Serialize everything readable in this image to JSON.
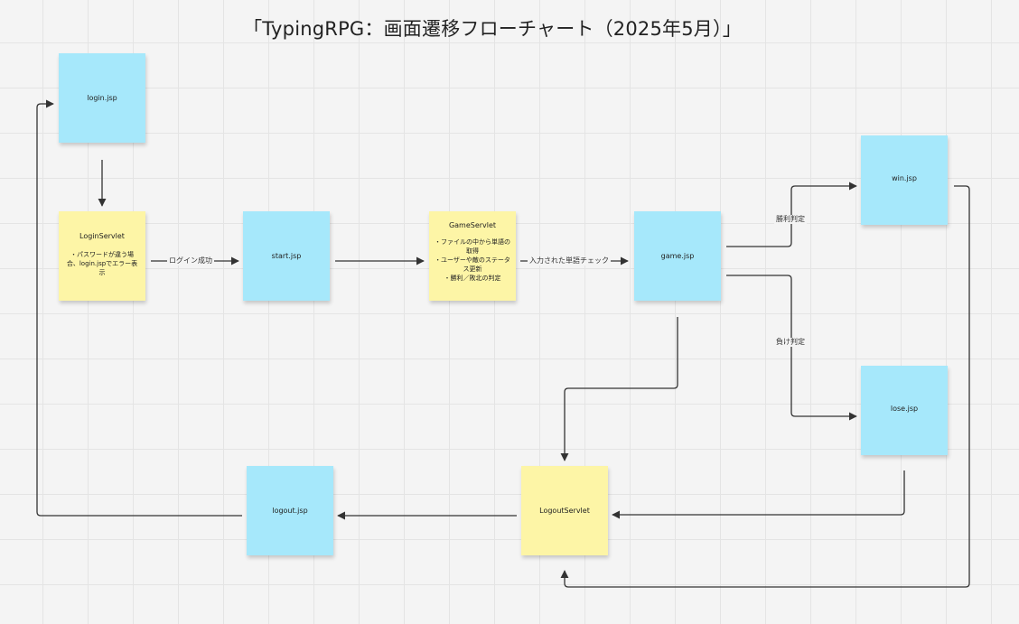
{
  "title": "「TypingRPG：画面遷移フローチャート（2025年5月）」",
  "colors": {
    "jsp_note": "#a6e8fb",
    "servlet_note": "#fdf5a6",
    "connector": "#333333",
    "background": "#f4f4f4"
  },
  "nodes": {
    "login_jsp": {
      "label": "login.jsp"
    },
    "login_servlet": {
      "label": "LoginServlet",
      "body": "・パスワードが違う場合、login.jspでエラー表示"
    },
    "start_jsp": {
      "label": "start.jsp"
    },
    "game_servlet": {
      "label": "GameServlet",
      "body": "・ファイルの中から単語の取得\n・ユーザーや敵のステータス更新\n・勝利／敗北の判定"
    },
    "game_jsp": {
      "label": "game.jsp"
    },
    "win_jsp": {
      "label": "win.jsp"
    },
    "lose_jsp": {
      "label": "lose.jsp"
    },
    "logout_servlet": {
      "label": "LogoutServlet"
    },
    "logout_jsp": {
      "label": "logout.jsp"
    }
  },
  "edges": [
    {
      "from": "login_jsp",
      "to": "login_servlet",
      "label": ""
    },
    {
      "from": "login_servlet",
      "to": "start_jsp",
      "label": "ログイン成功"
    },
    {
      "from": "start_jsp",
      "to": "game_servlet",
      "label": ""
    },
    {
      "from": "game_servlet",
      "to": "game_jsp",
      "label": "入力された単語チェック"
    },
    {
      "from": "game_jsp",
      "to": "win_jsp",
      "label": "勝利判定"
    },
    {
      "from": "game_jsp",
      "to": "lose_jsp",
      "label": "負け判定"
    },
    {
      "from": "game_jsp",
      "to": "logout_servlet",
      "label": ""
    },
    {
      "from": "lose_jsp",
      "to": "logout_servlet",
      "label": ""
    },
    {
      "from": "win_jsp",
      "to": "logout_servlet",
      "label": ""
    },
    {
      "from": "logout_servlet",
      "to": "logout_jsp",
      "label": ""
    },
    {
      "from": "logout_jsp",
      "to": "login_jsp",
      "label": ""
    }
  ]
}
